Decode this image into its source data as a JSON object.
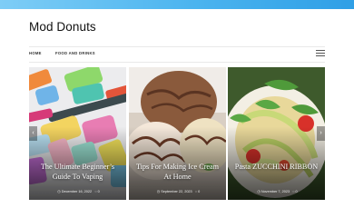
{
  "site": {
    "title": "Mod Donuts",
    "accent_color": "#4bb4ef"
  },
  "nav": {
    "items": [
      "HOME",
      "FOOD AND DRINKS"
    ],
    "menu_icon": "hamburger-menu-icon"
  },
  "slider": {
    "prev_icon": "chevron-left-icon",
    "next_icon": "chevron-right-icon",
    "prev_glyph": "‹",
    "next_glyph": "›",
    "posts": [
      {
        "title": "The Ultimate Beginner’s Guide To Vaping",
        "date": "December 16, 2022",
        "comments": "0",
        "image": "vape-devices-photo"
      },
      {
        "title": "Tips For Making Ice Cream At Home",
        "date": "September 22, 2023",
        "comments": "0",
        "image": "ice-cream-scoops-photo"
      },
      {
        "title": "Pasta ZUCCHINI RIBBON",
        "date": "November 7, 2023",
        "comments": "0",
        "image": "zucchini-pasta-photo"
      }
    ]
  }
}
